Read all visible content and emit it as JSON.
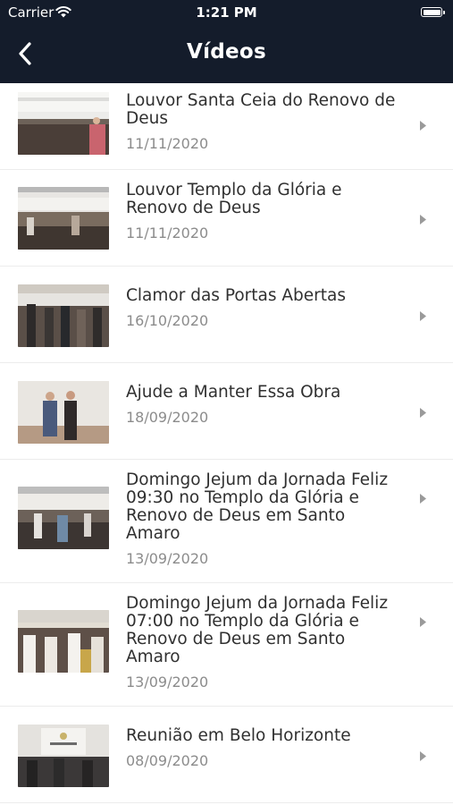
{
  "status_bar": {
    "carrier": "Carrier",
    "time": "1:21 PM"
  },
  "header": {
    "title": "Vídeos",
    "back_icon": "chevron-left-icon"
  },
  "colors": {
    "header_bg": "#141c2b",
    "title_text": "#303030",
    "date_text": "#8c8c8c",
    "chevron": "#9a9a9a"
  },
  "videos": [
    {
      "title": "Louvor Santa Ceia do Renovo de Deus",
      "date": "11/11/2020"
    },
    {
      "title": "Louvor Templo da Glória e Renovo de Deus",
      "date": "11/11/2020"
    },
    {
      "title": "Clamor das Portas Abertas",
      "date": "16/10/2020"
    },
    {
      "title": "Ajude a Manter Essa Obra",
      "date": "18/09/2020"
    },
    {
      "title": "Domingo Jejum da Jornada Feliz 09:30 no Templo da Glória e Renovo de Deus em Santo Amaro",
      "date": "13/09/2020"
    },
    {
      "title": "Domingo Jejum da Jornada Feliz 07:00 no Templo da Glória e Renovo de Deus em Santo Amaro",
      "date": "13/09/2020"
    },
    {
      "title": "Reunião em Belo Horizonte",
      "date": "08/09/2020"
    }
  ]
}
